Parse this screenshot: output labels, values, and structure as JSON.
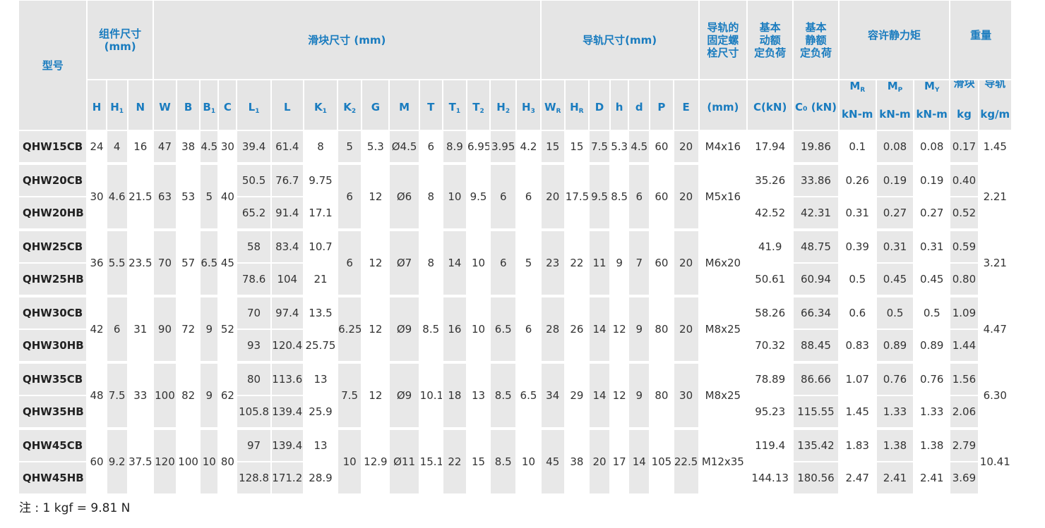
{
  "headers": {
    "model": "型号",
    "assembly": "组件尺寸\n(mm)",
    "block": "滑块尺寸 (mm)",
    "rail": "导轨尺寸(mm)",
    "bolt": "导轨的\n固定螺\n栓尺寸",
    "dyn": "基本\n动额\n定负荷",
    "stat": "基本\n静额\n定负荷",
    "moment": "容许静力矩",
    "weight": "重量",
    "block_w": "滑块",
    "rail_w": "导轨",
    "bolt_unit": "(mm)",
    "c_kn": "C(kN)",
    "c0_kn": "C₀ (kN)",
    "knm": "kN-m",
    "kg": "kg",
    "kgm": "kg/m"
  },
  "columns": [
    {
      "base": "H",
      "sub": ""
    },
    {
      "base": "H",
      "sub": "1"
    },
    {
      "base": "N",
      "sub": ""
    },
    {
      "base": "W",
      "sub": ""
    },
    {
      "base": "B",
      "sub": ""
    },
    {
      "base": "B",
      "sub": "1"
    },
    {
      "base": "C",
      "sub": ""
    },
    {
      "base": "L",
      "sub": "1"
    },
    {
      "base": "L",
      "sub": ""
    },
    {
      "base": "K",
      "sub": "1"
    },
    {
      "base": "K",
      "sub": "2"
    },
    {
      "base": "G",
      "sub": ""
    },
    {
      "base": "M",
      "sub": ""
    },
    {
      "base": "T",
      "sub": ""
    },
    {
      "base": "T",
      "sub": "1"
    },
    {
      "base": "T",
      "sub": "2"
    },
    {
      "base": "H",
      "sub": "2"
    },
    {
      "base": "H",
      "sub": "3"
    },
    {
      "base": "W",
      "sub": "R"
    },
    {
      "base": "H",
      "sub": "R"
    },
    {
      "base": "D",
      "sub": ""
    },
    {
      "base": "h",
      "sub": ""
    },
    {
      "base": "d",
      "sub": ""
    },
    {
      "base": "P",
      "sub": ""
    },
    {
      "base": "E",
      "sub": ""
    }
  ],
  "moments": [
    {
      "base": "M",
      "sub": "R"
    },
    {
      "base": "M",
      "sub": "P"
    },
    {
      "base": "M",
      "sub": "Y"
    }
  ],
  "groups": [
    {
      "rows": [
        {
          "model": "QHW15CB",
          "L1": "39.4",
          "L": "61.4",
          "K1": "8",
          "C": "17.94",
          "C0": "19.86",
          "MR": "0.1",
          "MP": "0.08",
          "MY": "0.08",
          "kg": "0.17"
        }
      ],
      "shared": {
        "H": "24",
        "H1": "4",
        "N": "16",
        "W": "47",
        "B": "38",
        "B1": "4.5",
        "Cc": "30",
        "K2": "5",
        "G": "5.3",
        "M": "Ø4.5",
        "T": "6",
        "T1": "8.9",
        "T2": "6.95",
        "H2": "3.95",
        "H3": "4.2",
        "WR": "15",
        "HR": "15",
        "D": "7.5",
        "h": "5.3",
        "d": "4.5",
        "P": "60",
        "E": "20",
        "bolt": "M4x16",
        "kgm": "1.45"
      }
    },
    {
      "rows": [
        {
          "model": "QHW20CB",
          "L1": "50.5",
          "L": "76.7",
          "K1": "9.75",
          "C": "35.26",
          "C0": "33.86",
          "MR": "0.26",
          "MP": "0.19",
          "MY": "0.19",
          "kg": "0.40"
        },
        {
          "model": "QHW20HB",
          "L1": "65.2",
          "L": "91.4",
          "K1": "17.1",
          "C": "42.52",
          "C0": "42.31",
          "MR": "0.31",
          "MP": "0.27",
          "MY": "0.27",
          "kg": "0.52"
        }
      ],
      "shared": {
        "H": "30",
        "H1": "4.6",
        "N": "21.5",
        "W": "63",
        "B": "53",
        "B1": "5",
        "Cc": "40",
        "K2": "6",
        "G": "12",
        "M": "Ø6",
        "T": "8",
        "T1": "10",
        "T2": "9.5",
        "H2": "6",
        "H3": "6",
        "WR": "20",
        "HR": "17.5",
        "D": "9.5",
        "h": "8.5",
        "d": "6",
        "P": "60",
        "E": "20",
        "bolt": "M5x16",
        "kgm": "2.21"
      }
    },
    {
      "rows": [
        {
          "model": "QHW25CB",
          "L1": "58",
          "L": "83.4",
          "K1": "10.7",
          "C": "41.9",
          "C0": "48.75",
          "MR": "0.39",
          "MP": "0.31",
          "MY": "0.31",
          "kg": "0.59"
        },
        {
          "model": "QHW25HB",
          "L1": "78.6",
          "L": "104",
          "K1": "21",
          "C": "50.61",
          "C0": "60.94",
          "MR": "0.5",
          "MP": "0.45",
          "MY": "0.45",
          "kg": "0.80"
        }
      ],
      "shared": {
        "H": "36",
        "H1": "5.5",
        "N": "23.5",
        "W": "70",
        "B": "57",
        "B1": "6.5",
        "Cc": "45",
        "K2": "6",
        "G": "12",
        "M": "Ø7",
        "T": "8",
        "T1": "14",
        "T2": "10",
        "H2": "6",
        "H3": "5",
        "WR": "23",
        "HR": "22",
        "D": "11",
        "h": "9",
        "d": "7",
        "P": "60",
        "E": "20",
        "bolt": "M6x20",
        "kgm": "3.21"
      }
    },
    {
      "rows": [
        {
          "model": "QHW30CB",
          "L1": "70",
          "L": "97.4",
          "K1": "13.5",
          "C": "58.26",
          "C0": "66.34",
          "MR": "0.6",
          "MP": "0.5",
          "MY": "0.5",
          "kg": "1.09"
        },
        {
          "model": "QHW30HB",
          "L1": "93",
          "L": "120.4",
          "K1": "25.75",
          "C": "70.32",
          "C0": "88.45",
          "MR": "0.83",
          "MP": "0.89",
          "MY": "0.89",
          "kg": "1.44"
        }
      ],
      "shared": {
        "H": "42",
        "H1": "6",
        "N": "31",
        "W": "90",
        "B": "72",
        "B1": "9",
        "Cc": "52",
        "K2": "6.25",
        "G": "12",
        "M": "Ø9",
        "T": "8.5",
        "T1": "16",
        "T2": "10",
        "H2": "6.5",
        "H3": "6",
        "WR": "28",
        "HR": "26",
        "D": "14",
        "h": "12",
        "d": "9",
        "P": "80",
        "E": "20",
        "bolt": "M8x25",
        "kgm": "4.47"
      }
    },
    {
      "rows": [
        {
          "model": "QHW35CB",
          "L1": "80",
          "L": "113.6",
          "K1": "13",
          "C": "78.89",
          "C0": "86.66",
          "MR": "1.07",
          "MP": "0.76",
          "MY": "0.76",
          "kg": "1.56"
        },
        {
          "model": "QHW35HB",
          "L1": "105.8",
          "L": "139.4",
          "K1": "25.9",
          "C": "95.23",
          "C0": "115.55",
          "MR": "1.45",
          "MP": "1.33",
          "MY": "1.33",
          "kg": "2.06"
        }
      ],
      "shared": {
        "H": "48",
        "H1": "7.5",
        "N": "33",
        "W": "100",
        "B": "82",
        "B1": "9",
        "Cc": "62",
        "K2": "7.5",
        "G": "12",
        "M": "Ø9",
        "T": "10.1",
        "T1": "18",
        "T2": "13",
        "H2": "8.5",
        "H3": "6.5",
        "WR": "34",
        "HR": "29",
        "D": "14",
        "h": "12",
        "d": "9",
        "P": "80",
        "E": "30",
        "bolt": "M8x25",
        "kgm": "6.30"
      }
    },
    {
      "rows": [
        {
          "model": "QHW45CB",
          "L1": "97",
          "L": "139.4",
          "K1": "13",
          "C": "119.4",
          "C0": "135.42",
          "MR": "1.83",
          "MP": "1.38",
          "MY": "1.38",
          "kg": "2.79"
        },
        {
          "model": "QHW45HB",
          "L1": "128.8",
          "L": "171.2",
          "K1": "28.9",
          "C": "144.13",
          "C0": "180.56",
          "MR": "2.47",
          "MP": "2.41",
          "MY": "2.41",
          "kg": "3.69"
        }
      ],
      "shared": {
        "H": "60",
        "H1": "9.2",
        "N": "37.5",
        "W": "120",
        "B": "100",
        "B1": "10",
        "Cc": "80",
        "K2": "10",
        "G": "12.9",
        "M": "Ø11",
        "T": "15.1",
        "T1": "22",
        "T2": "15",
        "H2": "8.5",
        "H3": "10",
        "WR": "45",
        "HR": "38",
        "D": "20",
        "h": "17",
        "d": "14",
        "P": "105",
        "E": "22.5",
        "bolt": "M12x35",
        "kgm": "10.41"
      }
    }
  ],
  "note": "注 : 1 kgf = 9.81 N"
}
